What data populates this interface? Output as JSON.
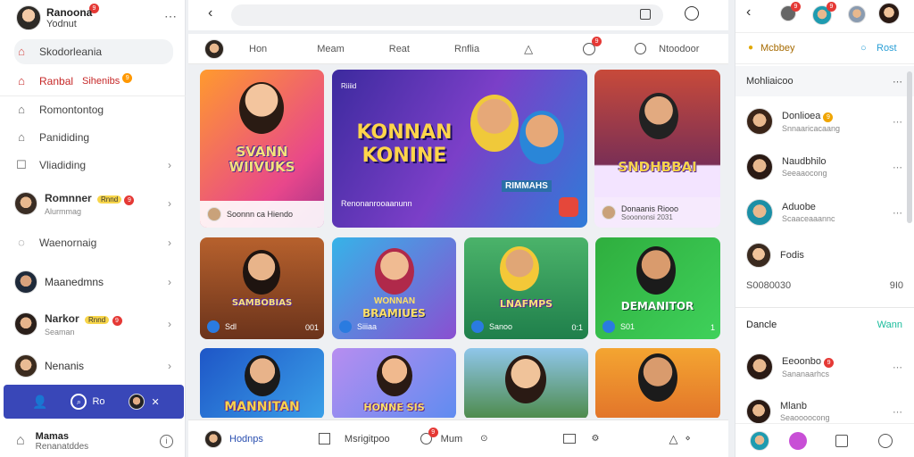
{
  "sidebar": {
    "profile": {
      "name": "Ranoona",
      "sub": "Yodnut",
      "badge": "9"
    },
    "items": [
      {
        "label": "Skodorleania",
        "icon": "home-icon"
      },
      {
        "label": "Ranbal",
        "extra": "Sihenibs",
        "badge": "9",
        "icon": "home-icon"
      },
      {
        "label": "Romontontog",
        "icon": "bookmark-icon"
      },
      {
        "label": "Panididing",
        "icon": "bookmark-icon"
      },
      {
        "label": "Vliadiding",
        "icon": "image-icon"
      }
    ],
    "people": [
      {
        "name": "Romnner",
        "tag": "Rnnd",
        "badge": "9",
        "sub": "Alurmmag"
      },
      {
        "label": "Waenornaig",
        "icon": "chat-icon"
      },
      {
        "name": "Maanedmns"
      },
      {
        "name": "Narkor",
        "tag": "Rnnd",
        "badge": "9",
        "sub": "Seaman"
      },
      {
        "name": "Nenanis"
      }
    ],
    "bar": {
      "label": "Ro"
    },
    "bottom": {
      "title": "Mamas",
      "sub": "Renanatddes"
    }
  },
  "center": {
    "nav": [
      "Hon",
      "Meam",
      "Reat",
      "Rnflia",
      "Ntoodoor"
    ],
    "nav_badge": "9",
    "cards": [
      {
        "title": "SVANN WIIVUKS",
        "foot": "Soonnn ca Hiendo"
      },
      {
        "title": "KONNAN KONINE",
        "tag": "Riiiid",
        "foot": "Renonanrooaanunn",
        "sub": "RIMMAHS"
      },
      {
        "title": "SNDHBBAI",
        "foot": "Donaanis Riooo",
        "sub": "Sooononsi 2031"
      },
      {
        "title": "SAMBOBIAS",
        "foot": "Sdl",
        "right": "001"
      },
      {
        "title": "BRAMIUES",
        "foot": "Siiiaa",
        "sub": "WONNAN"
      },
      {
        "title": "LNAFMPS",
        "foot": "Sanoo",
        "right": "0:1"
      },
      {
        "title": "DEMANITOR",
        "foot": "S01",
        "right": "1"
      },
      {
        "title": "MANNITAN"
      },
      {
        "title": "HONNE SIS"
      },
      {
        "title": ""
      },
      {
        "title": ""
      }
    ],
    "bottom": {
      "user": "Hodnps",
      "mid": "Msrigitpoo",
      "mid2": "Mum",
      "badge": "9"
    }
  },
  "right": {
    "header_badges": [
      "9",
      "9"
    ],
    "actions": {
      "left": "Mcbbey",
      "right": "Rost"
    },
    "section1": "Mohliaicoo",
    "contacts": [
      {
        "name": "Donlioea",
        "sub": "Snnaaricacaang",
        "badge": "9"
      },
      {
        "name": "Naudbhilo",
        "sub": "Seeaaocong"
      },
      {
        "name": "Aduobe",
        "sub": "Scaaceaaannc"
      },
      {
        "name": "Fodis",
        "sub": ""
      }
    ],
    "counter_left": "S0080030",
    "counter_right": "9I0",
    "section2": "Dancle",
    "section2_link": "Wann",
    "contacts2": [
      {
        "name": "Eeoonbo",
        "sub": "Sananaarhcs",
        "badge": "9"
      },
      {
        "name": "Mlanb",
        "sub": "Seaoooocong"
      }
    ]
  },
  "colors": {
    "accent": "#3947b8",
    "badge": "#e53935",
    "link": "#2a9fd6"
  }
}
